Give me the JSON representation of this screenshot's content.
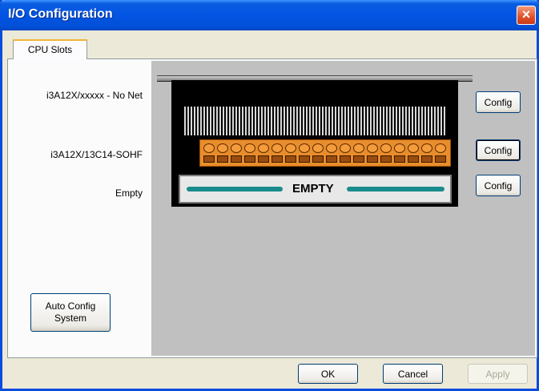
{
  "window": {
    "title": "I/O Configuration",
    "close_glyph": "×"
  },
  "tabs": [
    {
      "label": "CPU Slots"
    }
  ],
  "slots": [
    {
      "label": "i3A12X/xxxxx - No Net",
      "config_label": "Config"
    },
    {
      "label": "i3A12X/13C14-SOHF",
      "config_label": "Config"
    },
    {
      "label": "Empty",
      "config_label": "Config"
    }
  ],
  "empty_slot_text": "EMPTY",
  "auto_config": {
    "line1": "Auto Config",
    "line2": "System"
  },
  "footer": {
    "ok": "OK",
    "cancel": "Cancel",
    "apply": "Apply"
  },
  "colors": {
    "titlebar": "#0354e3",
    "module_orange": "#e88d2c",
    "empty_bar": "#1b8c8c",
    "rack": "#000000",
    "panel_grey": "#c0c0c0"
  }
}
